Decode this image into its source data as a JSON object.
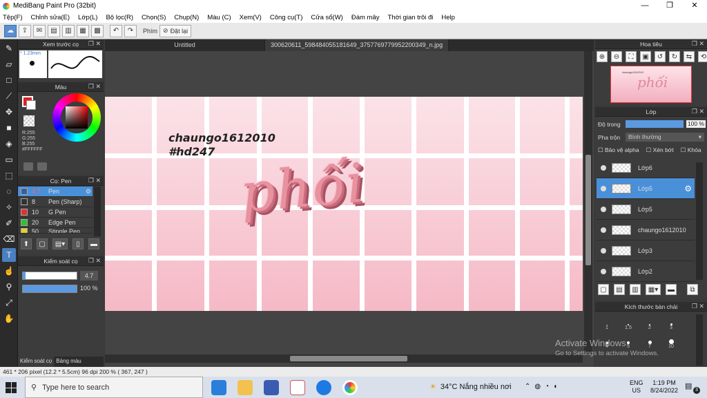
{
  "window": {
    "title": "MediBang Paint Pro (32bit)",
    "minimize": "—",
    "maximize": "❐",
    "close": "✕"
  },
  "menu": [
    "Tệp(F)",
    "Chỉnh sửa(E)",
    "Lớp(L)",
    "Bộ lọc(R)",
    "Chọn(S)",
    "Chụp(N)",
    "Màu (C)",
    "Xem(V)",
    "Công cụ(T)",
    "Cửa sổ(W)",
    "Đám mây",
    "Thời gian trôi đi",
    "Help"
  ],
  "toolbar": {
    "filter_label": "Phím",
    "reset_label": "Đặt lại"
  },
  "preview": {
    "title": "Xem trước cọ",
    "size": "* 1.23mm"
  },
  "color": {
    "title": "Màu",
    "r": "R:255",
    "g": "G:255",
    "b": "B:255",
    "hex": "#FFFFFF"
  },
  "brush": {
    "title": "Cọ: Pen",
    "items": [
      {
        "size": "4.7",
        "name": "Pen",
        "color": "#3a5fa0"
      },
      {
        "size": "8",
        "name": "Pen (Sharp)",
        "color": "#333333"
      },
      {
        "size": "10",
        "name": "G Pen",
        "color": "#e03030"
      },
      {
        "size": "20",
        "name": "Edge Pen",
        "color": "#30c030"
      },
      {
        "size": "50",
        "name": "Stipple Pen",
        "color": "#e0d030"
      }
    ]
  },
  "brush_control": {
    "title": "Kiểm soát cọ",
    "size": "4.7",
    "opacity": "100 %",
    "size_fill": 1.0,
    "opacity_fill": 1.0
  },
  "left_tabs": [
    "Kiểm soát cọ",
    "Bảng màu"
  ],
  "tabs": [
    "Untitled",
    "300620611_598484055181649_3757769779952200349_n.jpg"
  ],
  "artwork": {
    "caption1": "chaungo1612010",
    "caption2": "#hd247",
    "title": "phối"
  },
  "navigator": {
    "title": "Hoa tiêu",
    "thumb_text": "chaungo1612010"
  },
  "layer_panel": {
    "title": "Lớp",
    "opacity_label": "Độ trong",
    "opacity_value": "100 %",
    "blend_label": "Pha trộn",
    "blend_value": "Bình thường",
    "protect_alpha": "Bảo vệ alpha",
    "clipping": "Xén bớt",
    "lock": "Khóa",
    "layers": [
      "Lớp6",
      "Lớp5",
      "Lớp5",
      "chaungo1612010",
      "Lớp3",
      "Lớp2"
    ]
  },
  "brush_size_panel": {
    "title": "Kích thước bàn chải",
    "sizes": [
      "1",
      "1.5",
      "2",
      "3",
      "4",
      "5",
      "7",
      "10"
    ]
  },
  "status": "461 * 206 pixel  (12.2 * 5.5cm)  96 dpi  200 %  ( 367, 247 )",
  "watermark": {
    "line1": "Activate Windows",
    "line2": "Go to Settings to activate Windows."
  },
  "taskbar": {
    "search": "Type here to search",
    "weather": "34°C  Nắng nhiều nơi",
    "lang1": "ENG",
    "lang2": "US",
    "time": "1:19 PM",
    "date": "8/24/2022",
    "badge": "3"
  }
}
